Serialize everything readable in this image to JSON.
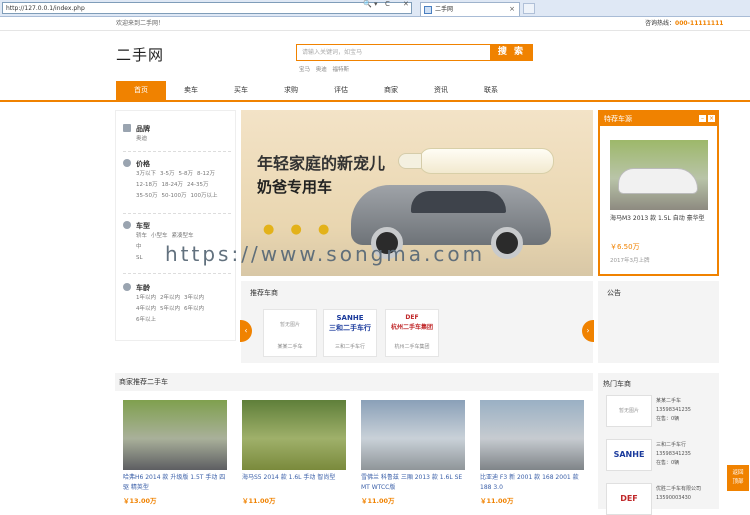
{
  "browser": {
    "url": "http://127.0.0.1/index.php",
    "tab_title": "二手网",
    "addr_icons": [
      "🔍 ▾",
      "C",
      "✕"
    ]
  },
  "topbar": {
    "welcome": "欢迎来到二手网！",
    "hotline_label": "咨询热线：",
    "hotline_number": "000-11111111"
  },
  "header": {
    "logo": "二手网",
    "search_placeholder": "请输入关键词，如宝马",
    "search_button": "搜 索",
    "hotwords": [
      "宝马",
      "奥迪",
      "福特斯"
    ]
  },
  "nav": {
    "items": [
      "首页",
      "卖车",
      "买车",
      "求购",
      "评估",
      "商家",
      "资讯",
      "联系"
    ],
    "active": 0
  },
  "filters": [
    {
      "title": "品牌",
      "rows": [
        [
          "奥迪"
        ]
      ]
    },
    {
      "title": "价格",
      "rows": [
        [
          "3万以下",
          "3-5万",
          "5-8万",
          "8-12万"
        ],
        [
          "12-18万",
          "18-24万",
          "24-35万"
        ],
        [
          "35-50万",
          "50-100万",
          "100万以上"
        ]
      ]
    },
    {
      "title": "车型",
      "rows": [
        [
          "轿车",
          "小型车",
          "紧凑型车"
        ],
        [
          "中"
        ],
        [
          "SL"
        ]
      ]
    },
    {
      "title": "车龄",
      "rows": [
        [
          "1年以内",
          "2年以内",
          "3年以内"
        ],
        [
          "4年以内",
          "5年以内",
          "6年以内"
        ],
        [
          "6年以上"
        ]
      ]
    }
  ],
  "banner": {
    "line1": "年轻家庭的新宠儿",
    "line2": "奶爸专用车",
    "ducks": "● ● ●"
  },
  "featured": {
    "title": "特荐车源",
    "car_name": "海马M3 2013 款 1.5L 自动 豪华型",
    "price": "￥6.50万",
    "date": "2017年3月上牌"
  },
  "brands": {
    "title": "推荐车商",
    "items": [
      {
        "logo": "暂无图片",
        "name": "某某二手车"
      },
      {
        "logo": "SANHE\n三和二手车行",
        "name": "三和二手车行"
      },
      {
        "logo": "DEF\n杭州二手车集团",
        "name": "杭州二手车集团"
      }
    ]
  },
  "notice": {
    "title": "公告"
  },
  "recommend": {
    "title": "商家推荐二手车",
    "cars": [
      {
        "title": "哈弗H6 2014 款 升级版 1.5T 手动 四驱 精英型",
        "price": "￥13.00万",
        "colors": [
          "#7fa04e",
          "#a9b09a",
          "#5d5e62"
        ]
      },
      {
        "title": "海马S5 2014 款 1.6L 手动 智尚型",
        "price": "￥11.00万",
        "colors": [
          "#5f7f3a",
          "#9fb06a",
          "#7a8a3c"
        ]
      },
      {
        "title": "雪佛兰 科鲁兹 三厢 2013 款 1.6L SE MT WTCC版",
        "price": "￥11.00万",
        "colors": [
          "#8aa0b8",
          "#c9d1d8",
          "#8f9599"
        ]
      },
      {
        "title": "比亚迪 F3 新 2001 款 168 2001 款 188 3.0",
        "price": "￥11.00万",
        "colors": [
          "#9ab0c4",
          "#c6cbd0",
          "#7f8488"
        ]
      }
    ]
  },
  "hotdealers": {
    "title": "热门车商",
    "items": [
      {
        "logo": "暂无图片",
        "lines": [
          "某某二手车",
          "13598341235",
          "在售：0辆"
        ]
      },
      {
        "logo": "SANHE",
        "lines": [
          "三和二手车行",
          "13598341235",
          "在售：0辆"
        ]
      },
      {
        "logo": "DEF",
        "lines": [
          "优胜二手车有限公司",
          "13590003430"
        ]
      }
    ]
  },
  "float_btn": "返回\n顶部",
  "watermark": "https://www.songma.com",
  "colors": {
    "accent": "#f08200",
    "link": "#3a5fa8"
  }
}
